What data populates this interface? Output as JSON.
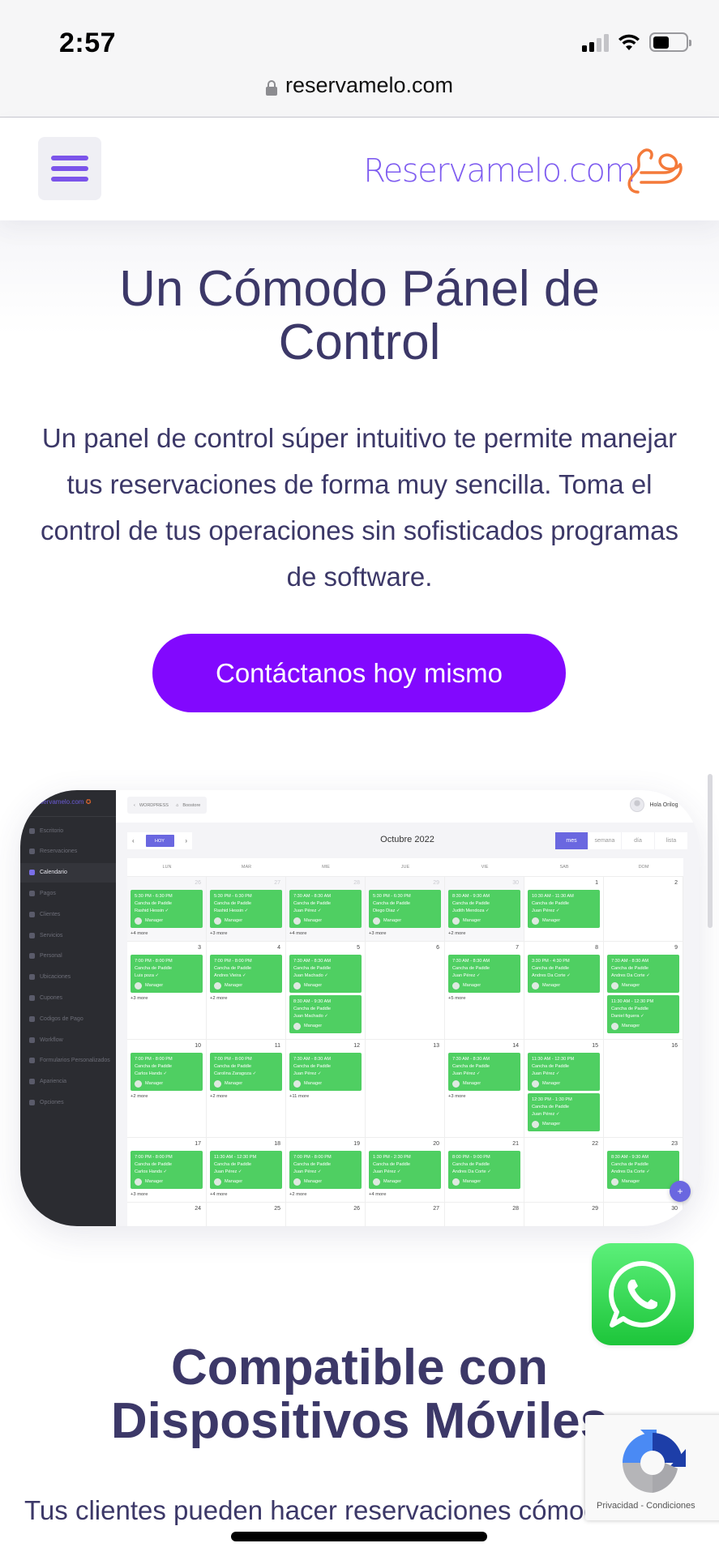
{
  "status_bar": {
    "time": "2:57",
    "signal_bars": 2,
    "signal_total": 4,
    "battery_percent": 50
  },
  "browser": {
    "url": "reservamelo.com",
    "lock_icon": "lock-icon"
  },
  "header": {
    "menu_icon": "hamburger-icon",
    "logo_text": "Reservamelo.com"
  },
  "hero": {
    "title": "Un Cómodo Pánel de Control",
    "text": "Un panel de control súper intuitivo te permite manejar tus reservaciones de forma muy sencilla. Toma el control de tus operaciones sin sofisticados programas de software.",
    "cta_label": "Contáctanos hoy mismo"
  },
  "dashboard": {
    "logo": "Reservamelo.com",
    "sidebar": [
      {
        "label": "Escritorio",
        "active": false
      },
      {
        "label": "Reservaciones",
        "active": false
      },
      {
        "label": "Calendario",
        "active": true
      },
      {
        "label": "Pagos",
        "active": false
      },
      {
        "label": "Clientes",
        "active": false
      },
      {
        "label": "Servicios",
        "active": false
      },
      {
        "label": "Personal",
        "active": false
      },
      {
        "label": "Ubicaciones",
        "active": false
      },
      {
        "label": "Cupones",
        "active": false
      },
      {
        "label": "Codigos de Pago",
        "active": false
      },
      {
        "label": "Workflow",
        "active": false
      },
      {
        "label": "Formularios Personalizados",
        "active": false
      },
      {
        "label": "Apariencia",
        "active": false
      },
      {
        "label": "Opciones",
        "active": false
      }
    ],
    "topbar": {
      "wordpress_label": "WORDPRESS",
      "boostore_label": "Boostore",
      "user_greeting": "Hola Orilog"
    },
    "calendar": {
      "today_label": "HOY",
      "prev": "‹",
      "next": "›",
      "title": "Octubre 2022",
      "views": [
        {
          "label": "mes",
          "active": true
        },
        {
          "label": "semana",
          "active": false
        },
        {
          "label": "día",
          "active": false
        },
        {
          "label": "lista",
          "active": false
        }
      ],
      "weekdays": [
        "LUN",
        "MAR",
        "MIE",
        "JUE",
        "VIE",
        "SAB",
        "DOM"
      ],
      "weeks": [
        [
          {
            "day": "26",
            "other": true,
            "events": [
              {
                "time": "5:30 PM - 6:30 PM",
                "service": "Cancha de Paddle",
                "client": "Rashid Hessin ✓",
                "staff": "Manager"
              }
            ],
            "more": "+4 more"
          },
          {
            "day": "27",
            "other": true,
            "events": [
              {
                "time": "5:30 PM - 6:30 PM",
                "service": "Cancha de Paddle",
                "client": "Rashid Hessin ✓",
                "staff": "Manager"
              }
            ],
            "more": "+3 more"
          },
          {
            "day": "28",
            "other": true,
            "events": [
              {
                "time": "7:30 AM - 8:30 AM",
                "service": "Cancha de Paddle",
                "client": "Juan Pérez ✓",
                "staff": "Manager"
              }
            ],
            "more": "+4 more"
          },
          {
            "day": "29",
            "other": true,
            "events": [
              {
                "time": "5:30 PM - 6:30 PM",
                "service": "Cancha de Paddle",
                "client": "Diego Diaz ✓",
                "staff": "Manager"
              }
            ],
            "more": "+3 more"
          },
          {
            "day": "30",
            "other": true,
            "events": [
              {
                "time": "8:30 AM - 9:30 AM",
                "service": "Cancha de Paddle",
                "client": "Judith Mendoza ✓",
                "staff": "Manager"
              }
            ],
            "more": "+2 more"
          },
          {
            "day": "1",
            "other": false,
            "events": [
              {
                "time": "10:30 AM - 11:30 AM",
                "service": "Cancha de Paddle",
                "client": "Juan Pérez ✓",
                "staff": "Manager"
              }
            ],
            "more": ""
          },
          {
            "day": "2",
            "other": false,
            "events": [],
            "more": ""
          }
        ],
        [
          {
            "day": "3",
            "other": false,
            "events": [
              {
                "time": "7:00 PM - 8:00 PM",
                "service": "Cancha de Paddle",
                "client": "Luis poza ✓",
                "staff": "Manager"
              }
            ],
            "more": "+3 more"
          },
          {
            "day": "4",
            "other": false,
            "events": [
              {
                "time": "7:00 PM - 8:00 PM",
                "service": "Cancha de Paddle",
                "client": "Andres Vieira ✓",
                "staff": "Manager"
              }
            ],
            "more": "+2 more"
          },
          {
            "day": "5",
            "other": false,
            "events": [
              {
                "time": "7:30 AM - 8:30 AM",
                "service": "Cancha de Paddle",
                "client": "Juan Machado ✓",
                "staff": "Manager"
              },
              {
                "time": "8:30 AM - 9:30 AM",
                "service": "Cancha de Paddle",
                "client": "Juan Machado ✓",
                "staff": "Manager"
              }
            ],
            "more": ""
          },
          {
            "day": "6",
            "other": false,
            "events": [],
            "more": ""
          },
          {
            "day": "7",
            "other": false,
            "events": [
              {
                "time": "7:30 AM - 8:30 AM",
                "service": "Cancha de Paddle",
                "client": "Juan Pérez ✓",
                "staff": "Manager"
              }
            ],
            "more": "+5 more"
          },
          {
            "day": "8",
            "other": false,
            "events": [
              {
                "time": "3:30 PM - 4:30 PM",
                "service": "Cancha de Paddle",
                "client": "Andres Da Corte ✓",
                "staff": "Manager"
              }
            ],
            "more": ""
          },
          {
            "day": "9",
            "other": false,
            "events": [
              {
                "time": "7:30 AM - 8:30 AM",
                "service": "Cancha de Paddle",
                "client": "Andres Da Corte ✓",
                "staff": "Manager"
              },
              {
                "time": "11:30 AM - 12:30 PM",
                "service": "Cancha de Paddle",
                "client": "Daniel figuera ✓",
                "staff": "Manager"
              }
            ],
            "more": ""
          }
        ],
        [
          {
            "day": "10",
            "other": false,
            "events": [
              {
                "time": "7:00 PM - 8:00 PM",
                "service": "Cancha de Paddle",
                "client": "Carlos Hands ✓",
                "staff": "Manager"
              }
            ],
            "more": "+2 more"
          },
          {
            "day": "11",
            "other": false,
            "events": [
              {
                "time": "7:00 PM - 8:00 PM",
                "service": "Cancha de Paddle",
                "client": "Carolina Zaragoza ✓",
                "staff": "Manager"
              }
            ],
            "more": "+2 more"
          },
          {
            "day": "12",
            "other": false,
            "events": [
              {
                "time": "7:30 AM - 8:30 AM",
                "service": "Cancha de Paddle",
                "client": "Juan Pérez ✓",
                "staff": "Manager"
              }
            ],
            "more": "+11 more"
          },
          {
            "day": "13",
            "other": false,
            "events": [],
            "more": ""
          },
          {
            "day": "14",
            "other": false,
            "events": [
              {
                "time": "7:30 AM - 8:30 AM",
                "service": "Cancha de Paddle",
                "client": "Juan Pérez ✓",
                "staff": "Manager"
              }
            ],
            "more": "+3 more"
          },
          {
            "day": "15",
            "other": false,
            "events": [
              {
                "time": "11:30 AM - 12:30 PM",
                "service": "Cancha de Paddle",
                "client": "Juan Pérez ✓",
                "staff": "Manager"
              },
              {
                "time": "12:30 PM - 1:30 PM",
                "service": "Cancha de Paddle",
                "client": "Juan Pérez ✓",
                "staff": "Manager"
              }
            ],
            "more": ""
          },
          {
            "day": "16",
            "other": false,
            "events": [],
            "more": ""
          }
        ],
        [
          {
            "day": "17",
            "other": false,
            "events": [
              {
                "time": "7:00 PM - 8:00 PM",
                "service": "Cancha de Paddle",
                "client": "Carlos Hands ✓",
                "staff": "Manager"
              }
            ],
            "more": "+3 more"
          },
          {
            "day": "18",
            "other": false,
            "events": [
              {
                "time": "11:30 AM - 12:30 PM",
                "service": "Cancha de Paddle",
                "client": "Juan Pérez ✓",
                "staff": "Manager"
              }
            ],
            "more": "+4 more"
          },
          {
            "day": "19",
            "other": false,
            "events": [
              {
                "time": "7:00 PM - 8:00 PM",
                "service": "Cancha de Paddle",
                "client": "Juan Pérez ✓",
                "staff": "Manager"
              }
            ],
            "more": "+2 more"
          },
          {
            "day": "20",
            "other": false,
            "events": [
              {
                "time": "1:30 PM - 2:30 PM",
                "service": "Cancha de Paddle",
                "client": "Juan Pérez ✓",
                "staff": "Manager"
              }
            ],
            "more": "+4 more"
          },
          {
            "day": "21",
            "other": false,
            "events": [
              {
                "time": "8:00 PM - 9:00 PM",
                "service": "Cancha de Paddle",
                "client": "Andres Da Corte ✓",
                "staff": "Manager"
              }
            ],
            "more": ""
          },
          {
            "day": "22",
            "other": false,
            "events": [],
            "more": ""
          },
          {
            "day": "23",
            "other": false,
            "events": [
              {
                "time": "8:30 AM - 9:30 AM",
                "service": "Cancha de Paddle",
                "client": "Andres Da Corte ✓",
                "staff": "Manager"
              }
            ],
            "more": ""
          }
        ],
        [
          {
            "day": "24",
            "other": false,
            "events": [],
            "more": ""
          },
          {
            "day": "25",
            "other": false,
            "events": [],
            "more": ""
          },
          {
            "day": "26",
            "other": false,
            "events": [],
            "more": ""
          },
          {
            "day": "27",
            "other": false,
            "events": [],
            "more": ""
          },
          {
            "day": "28",
            "other": false,
            "events": [],
            "more": ""
          },
          {
            "day": "29",
            "other": false,
            "events": [],
            "more": ""
          },
          {
            "day": "30",
            "other": false,
            "events": [],
            "more": ""
          }
        ]
      ],
      "fab_label": "+"
    }
  },
  "section2": {
    "title": "Compatible con Dispositivos Móviles",
    "text": "Tus clientes pueden hacer reservaciones cómodamente desde sus dispositivos"
  },
  "whatsapp": {
    "icon": "whatsapp-icon"
  },
  "recaptcha": {
    "links": "Privacidad - Condiciones"
  },
  "colors": {
    "brand_purple": "#8208fe",
    "heading": "#3c3868",
    "logo_purple": "#7f5df0",
    "logo_orange": "#f47a3a",
    "event_green": "#4fcf62",
    "calendar_accent": "#6a67e0",
    "whatsapp_green": "#25d366"
  }
}
